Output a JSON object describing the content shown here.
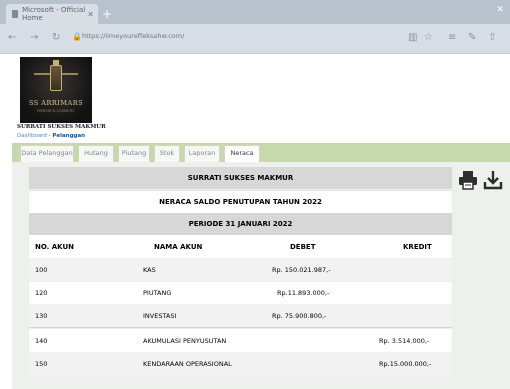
{
  "browser": {
    "tab_title": "Microsoft - Official Home",
    "url": "https://limeyoureffeksahw.com/",
    "colors": {
      "chrome": "#b8c2cc",
      "address_bar": "#d7dde4"
    }
  },
  "header": {
    "logo_text": "SS ARRIMARS",
    "logo_tagline": "PARFUM & COSMETIC",
    "company_name": "SURRATI SUKSES MAKMUR",
    "breadcrumb": {
      "home": "Dashboard",
      "separator": " - ",
      "current": "Pelanggan"
    }
  },
  "menu": [
    {
      "label": "Data Pelanggan",
      "active": false
    },
    {
      "label": "Hutang",
      "active": false
    },
    {
      "label": "Piutang",
      "active": false
    },
    {
      "label": "Stok",
      "active": false
    },
    {
      "label": "Laporan",
      "active": false
    },
    {
      "label": "Neraca",
      "active": true
    }
  ],
  "toolbar": {
    "print_icon": "printer-icon",
    "download_icon": "download-icon"
  },
  "report": {
    "company": "SURRATI SUKSES MAKMUR",
    "title": "NERACA SALDO PENUTUPAN TAHUN 2022",
    "period": "PERIODE 31 JANUARI 2022",
    "columns": [
      "NO. AKUN",
      "NAMA AKUN",
      "DEBET",
      "KREDIT"
    ],
    "rows": [
      {
        "no": "100",
        "name": "KAS",
        "debet": "Rp. 150.021.987,-",
        "kredit": ""
      },
      {
        "no": "120",
        "name": "PIUTANG",
        "debet": "Rp.11.893.000,-",
        "kredit": ""
      },
      {
        "no": "130",
        "name": "INVESTASI",
        "debet": "Rp. 75.900.800,-",
        "kredit": ""
      },
      {
        "no": "140",
        "name": "AKUMULASI PENYUSUTAN",
        "debet": "",
        "kredit": "Rp. 3.514.000,-"
      },
      {
        "no": "150",
        "name": "KENDARAAN OPERASIONAL",
        "debet": "",
        "kredit": "Rp.15.000.000,-"
      }
    ]
  },
  "colors": {
    "menubar": "#c7d9ac",
    "header_row": "#d7d7d7",
    "link": "#4f86c6"
  }
}
